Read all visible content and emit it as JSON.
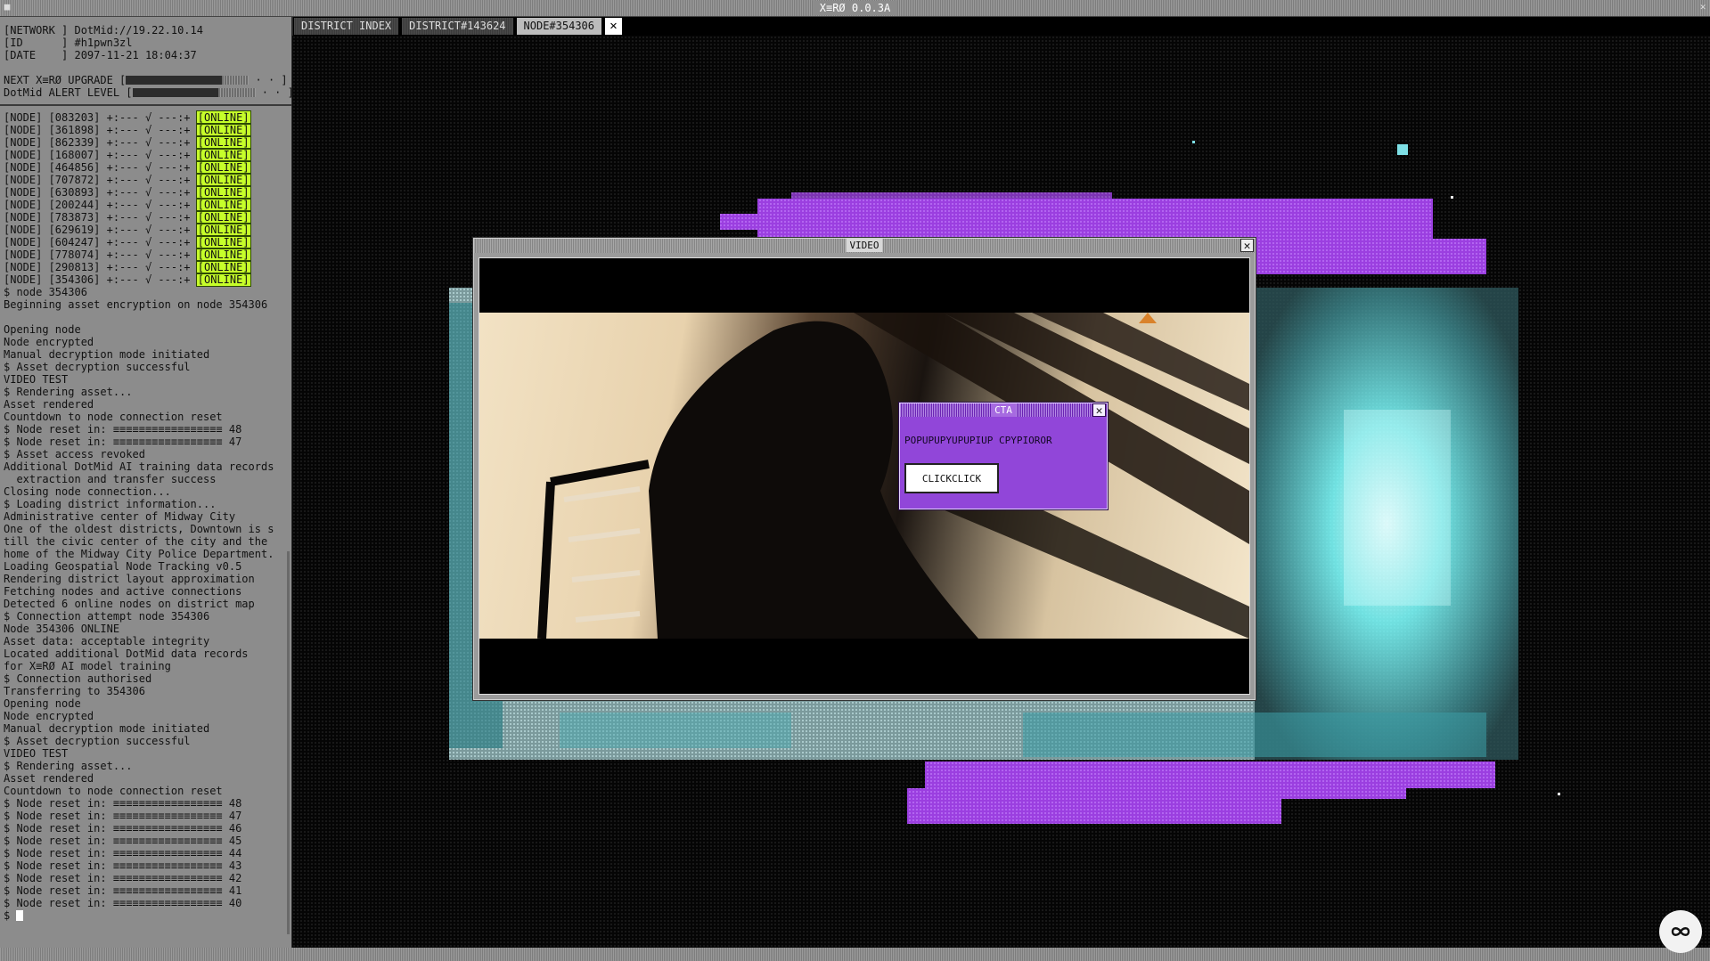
{
  "app": {
    "title": "X≡RØ 0.0.3A"
  },
  "tabs": [
    {
      "label": "DISTRICT INDEX",
      "active": false
    },
    {
      "label": "DISTRICT#143624",
      "active": false
    },
    {
      "label": "NODE#354306",
      "active": true
    }
  ],
  "tab_close_label": "✕",
  "terminal": {
    "header": [
      "[NETWORK ] DotMid://19.22.10.14",
      "[ID      ] #h1pwn3zl",
      "[DATE    ] 2097-11-21 18:04:37"
    ],
    "upgrade_label": "NEXT X≡RØ UPGRADE [",
    "upgrade_fill": 0.78,
    "alert_label": "DotMid ALERT LEVEL [",
    "alert_fill": 0.7,
    "bar_tail": " · · ]",
    "node_status_label": "[ONLINE]",
    "node_pattern": " +:--- √ ---:+ ",
    "nodes": [
      "083203",
      "361898",
      "862339",
      "168007",
      "464856",
      "707872",
      "630893",
      "200244",
      "783873",
      "629619",
      "604247",
      "778074",
      "290813",
      "354306"
    ],
    "log": [
      "$ node 354306",
      "Beginning asset encryption on node 354306",
      "",
      "Opening node",
      "Node encrypted",
      "Manual decryption mode initiated",
      "$ Asset decryption successful",
      "VIDEO TEST",
      "$ Rendering asset...",
      "Asset rendered",
      "Countdown to node connection reset",
      "$ Node reset in: ≡≡≡≡≡≡≡≡≡≡≡≡≡≡≡≡≡ 48",
      "$ Node reset in: ≡≡≡≡≡≡≡≡≡≡≡≡≡≡≡≡≡ 47",
      "$ Asset access revoked",
      "Additional DotMid AI training data records",
      "  extraction and transfer success",
      "Closing node connection...",
      "$ Loading district information...",
      "Administrative center of Midway City",
      "One of the oldest districts, Downtown is s",
      "till the civic center of the city and the",
      "home of the Midway City Police Department.",
      "Loading Geospatial Node Tracking v0.5",
      "Rendering district layout approximation",
      "Fetching nodes and active connections",
      "Detected 6 online nodes on district map",
      "$ Connection attempt node 354306",
      "Node 354306 ONLINE",
      "Asset data: acceptable integrity",
      "Located additional DotMid data records",
      "for X≡RØ AI model training",
      "$ Connection authorised",
      "Transferring to 354306",
      "Opening node",
      "Node encrypted",
      "Manual decryption mode initiated",
      "$ Asset decryption successful",
      "VIDEO TEST",
      "$ Rendering asset...",
      "Asset rendered",
      "Countdown to node connection reset",
      "$ Node reset in: ≡≡≡≡≡≡≡≡≡≡≡≡≡≡≡≡≡ 48",
      "$ Node reset in: ≡≡≡≡≡≡≡≡≡≡≡≡≡≡≡≡≡ 47",
      "$ Node reset in: ≡≡≡≡≡≡≡≡≡≡≡≡≡≡≡≡≡ 46",
      "$ Node reset in: ≡≡≡≡≡≡≡≡≡≡≡≡≡≡≡≡≡ 45",
      "$ Node reset in: ≡≡≡≡≡≡≡≡≡≡≡≡≡≡≡≡≡ 44",
      "$ Node reset in: ≡≡≡≡≡≡≡≡≡≡≡≡≡≡≡≡≡ 43",
      "$ Node reset in: ≡≡≡≡≡≡≡≡≡≡≡≡≡≡≡≡≡ 42",
      "$ Node reset in: ≡≡≡≡≡≡≡≡≡≡≡≡≡≡≡≡≡ 41",
      "$ Node reset in: ≡≡≡≡≡≡≡≡≡≡≡≡≡≡≡≡≡ 40"
    ],
    "prompt": "$ "
  },
  "video_window": {
    "title": "VIDEO",
    "close_label": "✕"
  },
  "cta": {
    "title": "CTA",
    "close_label": "✕",
    "message": "POPUPUPYUPUPIUP CPYPIOROR",
    "button_label": "CLICKCLICK"
  },
  "colors": {
    "online_badge": "#c6ff2a",
    "glitch_purple": "#9b3fe0",
    "glitch_cyan": "#6fe8e8",
    "cta_bg": "#9146d9",
    "terminal_bg": "#8c8c8c"
  },
  "icons": {
    "assist": "infinity-icon",
    "close": "close-icon",
    "cursor": "cursor-block"
  }
}
